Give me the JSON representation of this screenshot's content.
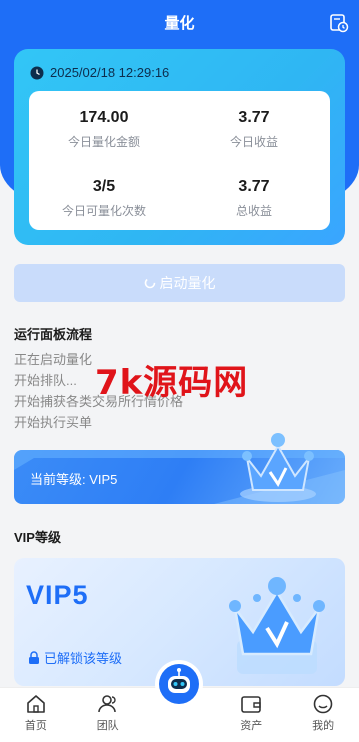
{
  "header": {
    "title": "量化",
    "history_icon": "history-icon"
  },
  "stats": {
    "datetime": "2025/02/18 12:29:16",
    "clock_icon": "clock-icon",
    "items": [
      {
        "value": "174.00",
        "label": "今日量化金额"
      },
      {
        "value": "3.77",
        "label": "今日收益"
      },
      {
        "value": "3/5",
        "label": "今日可量化次数"
      },
      {
        "value": "3.77",
        "label": "总收益"
      }
    ]
  },
  "start_button": {
    "label": "启动量化",
    "icon": "spinner-icon"
  },
  "process": {
    "title": "运行面板流程",
    "steps": [
      "正在启动量化",
      "开始排队...",
      "开始捕获各类交易所行情价格",
      "开始执行买单"
    ]
  },
  "watermark": "7k源码网",
  "current_level": {
    "label": "当前等级: VIP5",
    "icon": "crown-icon"
  },
  "vip_section": {
    "title": "VIP等级",
    "card": {
      "name": "VIP5",
      "status": "已解锁该等级",
      "lock_icon": "lock-icon",
      "icon": "crown-icon"
    }
  },
  "bottom_nav": {
    "items": [
      {
        "label": "首页",
        "icon": "home-icon"
      },
      {
        "label": "团队",
        "icon": "team-icon"
      },
      {
        "label": "",
        "icon": "robot-icon"
      },
      {
        "label": "资产",
        "icon": "wallet-icon"
      },
      {
        "label": "我的",
        "icon": "profile-icon"
      }
    ]
  },
  "colors": {
    "primary": "#1e6ef7",
    "card_gradient": "#32c6f6",
    "watermark": "#e0141a"
  }
}
